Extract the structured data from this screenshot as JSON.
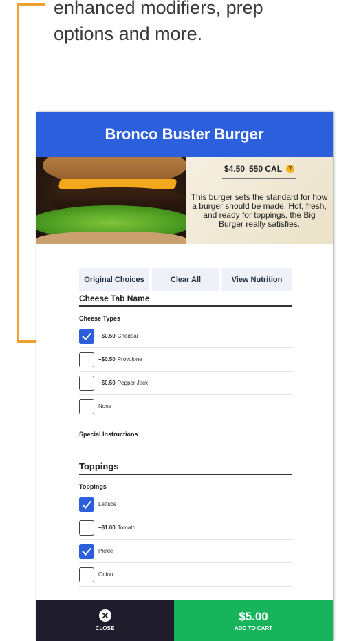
{
  "caption": {
    "line1": "enhanced modifiers, prep",
    "line2": "options and more."
  },
  "colors": {
    "header": "#2c5fdc",
    "callout": "#f0a030",
    "checkbox_checked": "#2c5fdc",
    "close_bg": "#1f1d2c",
    "cart_bg": "#17b45c"
  },
  "item": {
    "title": "Bronco Buster Burger",
    "price": "$4.50",
    "calories": "550 CAL",
    "badge": "Y",
    "description": "This burger sets the standard for how a burger should be made. Hot, fresh, and ready for toppings, the Big Burger really satisfies."
  },
  "actions": {
    "original": "Original Choices",
    "clear": "Clear All",
    "nutrition": "View Nutrition"
  },
  "cheese": {
    "tab_title": "Cheese Tab Name",
    "group_label": "Cheese Types",
    "options": [
      {
        "price": "+$0.50",
        "name": "Cheddar",
        "checked": true
      },
      {
        "price": "+$0.50",
        "name": "Provolone",
        "checked": false
      },
      {
        "price": "+$0.50",
        "name": "Pepper Jack",
        "checked": false
      },
      {
        "price": "",
        "name": "None",
        "checked": false
      }
    ]
  },
  "special_instructions": "Special Instructions",
  "toppings": {
    "tab_title": "Toppings",
    "group_label": "Toppings",
    "options": [
      {
        "price": "",
        "name": "Lettuce",
        "checked": true
      },
      {
        "price": "+$1.00",
        "name": "Tomato",
        "checked": false
      },
      {
        "price": "",
        "name": "Pickle",
        "checked": true
      },
      {
        "price": "",
        "name": "Onion",
        "checked": false
      }
    ]
  },
  "footer": {
    "close_label": "CLOSE",
    "cart_total": "$5.00",
    "cart_label": "ADD TO CART"
  }
}
